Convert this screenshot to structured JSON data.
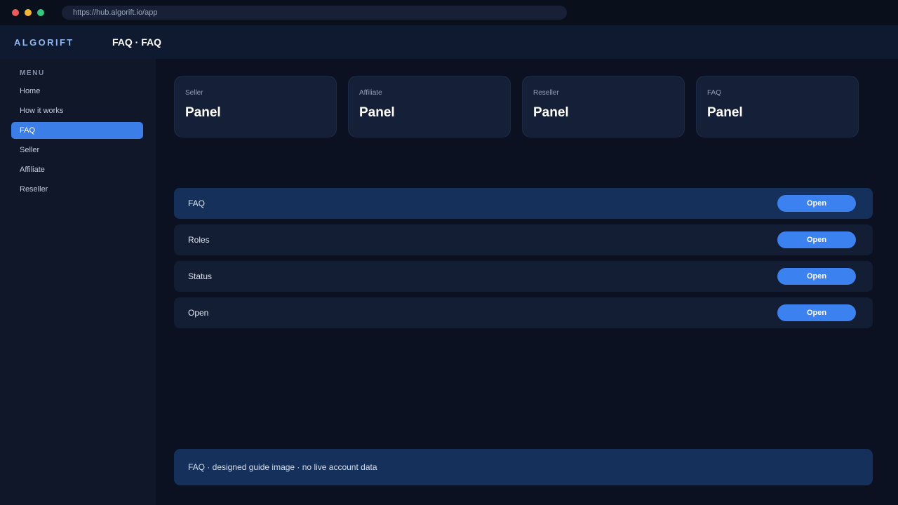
{
  "browser": {
    "url": "https://hub.algorift.io/app"
  },
  "header": {
    "brand": "ALGORIFT",
    "title": "FAQ · FAQ"
  },
  "sidebar": {
    "heading": "MENU",
    "items": [
      {
        "label": "Home",
        "active": false
      },
      {
        "label": "How it works",
        "active": false
      },
      {
        "label": "FAQ",
        "active": true
      },
      {
        "label": "Seller",
        "active": false
      },
      {
        "label": "Affiliate",
        "active": false
      },
      {
        "label": "Reseller",
        "active": false
      }
    ]
  },
  "cards": [
    {
      "label": "Seller",
      "value": "Panel"
    },
    {
      "label": "Affiliate",
      "value": "Panel"
    },
    {
      "label": "Reseller",
      "value": "Panel"
    },
    {
      "label": "FAQ",
      "value": "Panel"
    }
  ],
  "rows": [
    {
      "label": "FAQ",
      "button": "Open",
      "highlighted": true
    },
    {
      "label": "Roles",
      "button": "Open",
      "highlighted": false
    },
    {
      "label": "Status",
      "button": "Open",
      "highlighted": false
    },
    {
      "label": "Open",
      "button": "Open",
      "highlighted": false
    }
  ],
  "footer": {
    "note": "FAQ · designed guide image · no live account data"
  },
  "colors": {
    "accent": "#3b82f0",
    "background": "#0b1120",
    "panel": "#152038",
    "highlight": "#15305a"
  }
}
